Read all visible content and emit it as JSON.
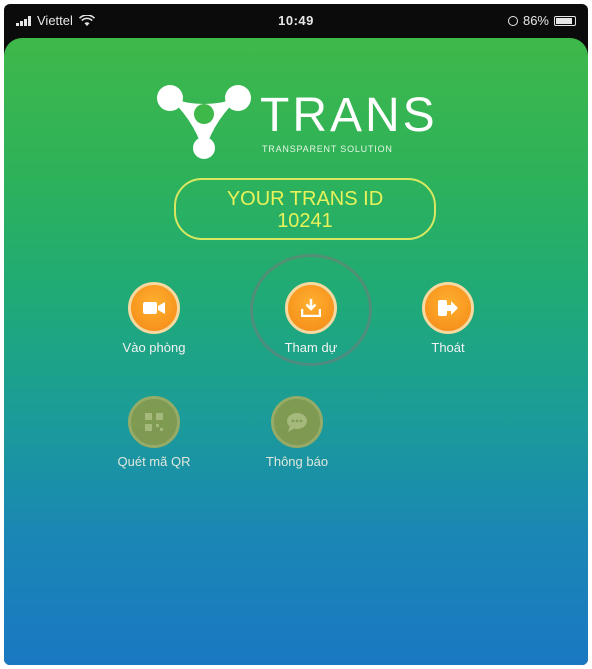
{
  "status_bar": {
    "carrier": "Viettel",
    "time": "10:49",
    "battery": "86%"
  },
  "brand": {
    "name": "TRANS",
    "tagline": "TRANSPARENT SOLUTION"
  },
  "trans_id": {
    "label": "YOUR TRANS ID",
    "value": "10241"
  },
  "menu": {
    "join_room": {
      "label": "Vào phòng",
      "icon": "video-camera-icon"
    },
    "attend": {
      "label": "Tham dự",
      "icon": "download-tray-icon"
    },
    "exit": {
      "label": "Thoát",
      "icon": "logout-arrow-icon"
    },
    "scan_qr": {
      "label": "Quét mã QR",
      "icon": "qr-code-icon"
    },
    "notifications": {
      "label": "Thông báo",
      "icon": "chat-bubble-icon"
    }
  },
  "colors": {
    "accent_orange": "#f7941d",
    "id_yellow": "#e8f25a",
    "gradient_top": "#3fb84a",
    "gradient_bottom": "#1a78c2"
  }
}
